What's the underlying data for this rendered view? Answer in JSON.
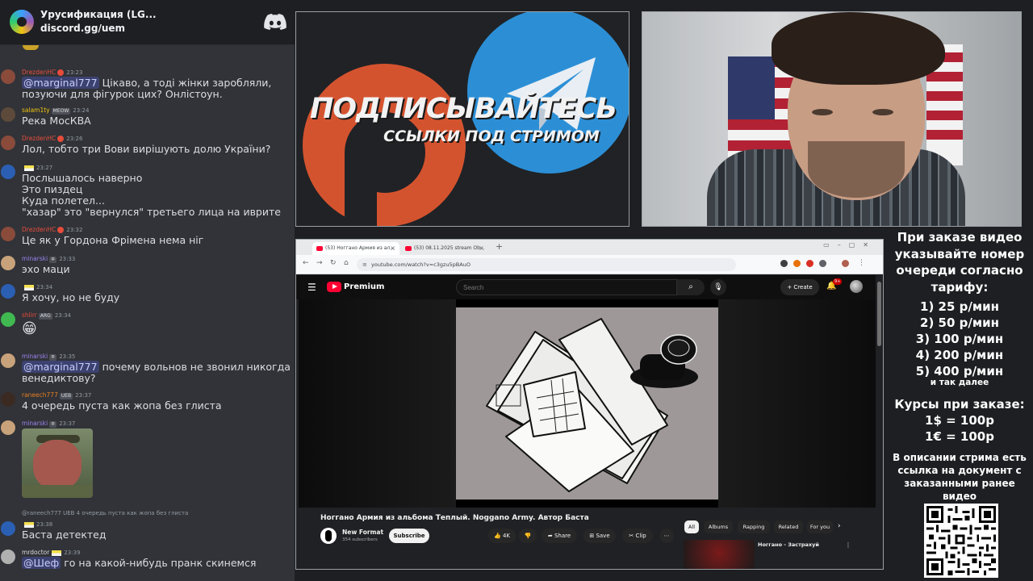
{
  "server": {
    "name": "Урусификация (LG...",
    "invite": "discord.gg/uem"
  },
  "chat": {
    "messages": [
      {
        "nick": "DrezdenHC",
        "time": "23:23",
        "text": "Цікаво, а тоді жінки заробляли,\nпозуючи для фігурок цих? Онлістоун.",
        "mention": "@marginal777",
        "nick_color": "#e74c3c"
      },
      {
        "nick": "salam1ty",
        "badge": "MEOW",
        "time": "23:24",
        "text": "Река МосКВА",
        "nick_color": "#f1c40f"
      },
      {
        "nick": "DrezdenHC",
        "time": "23:26",
        "text": "Лол, тобто три Вови вирішують долю України?",
        "nick_color": "#e74c3c"
      },
      {
        "nick": "",
        "time": "23:27",
        "text": "Послышалось наверно\nЭто пиздец\nКуда полетел...\n\"хазар\" это \"вернулся\" третьего лица на иврите",
        "nick_color": "#f1c40f"
      },
      {
        "nick": "DrezdenHC",
        "time": "23:32",
        "text": "Це як у Гордона Фрімена нема ніг",
        "nick_color": "#e74c3c"
      },
      {
        "nick": "minarski",
        "time": "23:33",
        "text": "эхо маци",
        "nick_color": "#9b84ee"
      },
      {
        "nick": "",
        "time": "23:34",
        "text": "Я хочу, но не буду",
        "nick_color": "#f1c40f"
      },
      {
        "nick": "shlirr",
        "badge": "ARG",
        "time": "23:34",
        "text": "😁",
        "nick_color": "#e74c3c"
      },
      {
        "nick": "minarski",
        "time": "23:35",
        "text": "почему вольнов не звонил никогда\nвенедиктову?",
        "mention": "@marginal777",
        "nick_color": "#9b84ee"
      },
      {
        "nick": "raneech777",
        "badge": "UEB",
        "time": "23:37",
        "text": "4 очередь пуста как жопа без глиста",
        "nick_color": "#e67e22"
      },
      {
        "nick": "minarski",
        "time": "23:37",
        "text": "",
        "nick_color": "#9b84ee"
      },
      {
        "nick": "",
        "time": "23:38",
        "reply": "@raneech777 UEB 4 очередь пуста как жопа без глиста",
        "text": "Баста детектед",
        "nick_color": "#f1c40f"
      },
      {
        "nick": "mrdoctor",
        "time": "23:39",
        "text": "го на какой-нибудь пранк скинемся",
        "mention": "@Шеф",
        "nick_color": "#dbdee1"
      }
    ]
  },
  "promo": {
    "title": "ПОДПИСЫВАЙТЕСЬ",
    "subtitle": "ССЫЛКИ ПОД СТРИМОМ",
    "colors": {
      "patreon": "#d4532f",
      "telegram": "#2c8fd6"
    }
  },
  "browser": {
    "tabs": [
      {
        "label": "(53) Ноггано Армия из ал..."
      },
      {
        "label": "(53) 08.11.2025 stream Ob..."
      }
    ],
    "new_tab": "+",
    "url": "youtube.com/watch?v=c3gzu5pBAuO",
    "youtube": {
      "brand": "Premium",
      "search_placeholder": "Search",
      "create_label": "Create",
      "notifications": "9+",
      "video_title": "Ноггано Армия из альбома Теплый. Noggano Army. Автор Баста",
      "channel_name": "New Format",
      "channel_subs": "354 subscribers",
      "subscribe_label": "Subscribe",
      "likes": "4K",
      "share_label": "Share",
      "save_label": "Save",
      "clip_label": "Clip",
      "chips": [
        "All",
        "Albums",
        "Rapping",
        "Related",
        "For you"
      ],
      "recommendation_title": "Ноггано - Застрахуй"
    }
  },
  "pricing": {
    "intro": "При заказе видео указывайте номер очереди согласно тарифу:",
    "rates": [
      "1) 25 р/мин",
      "2) 50 р/мин",
      "3) 100 р/мин",
      "4) 200 р/мин",
      "5) 400 р/мин"
    ],
    "etc": "и так далее",
    "currency_title": "Курсы при заказе:",
    "currency": [
      "1$ = 100р",
      "1€ = 100р"
    ],
    "description": "В описании стрима есть ссылка на документ с заказанными ранее видео"
  }
}
